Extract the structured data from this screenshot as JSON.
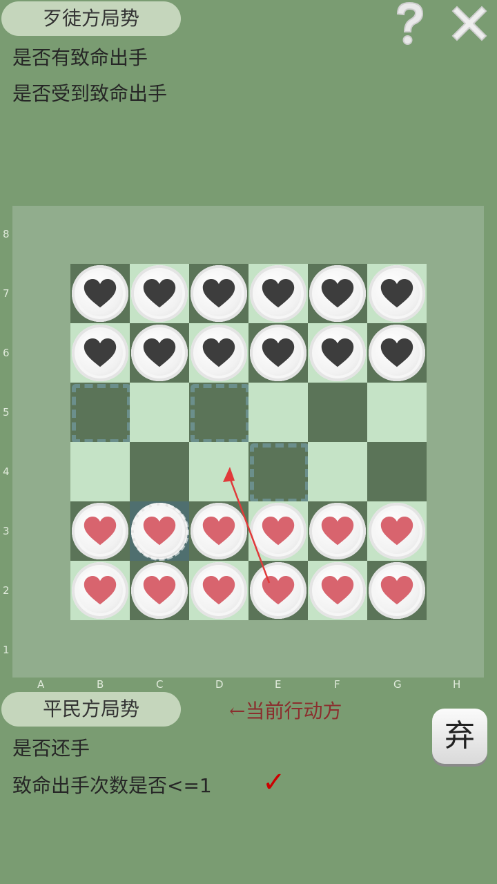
{
  "top_panel": {
    "title": "歹徒方局势",
    "lines": [
      "是否有致命出手",
      "是否受到致命出手"
    ]
  },
  "icons": {
    "help": "question-mark-icon",
    "close": "close-x-icon"
  },
  "board": {
    "rows": [
      "8",
      "7",
      "6",
      "5",
      "4",
      "3",
      "2",
      "1"
    ],
    "cols": [
      "A",
      "B",
      "C",
      "D",
      "E",
      "F",
      "G",
      "H"
    ],
    "colors": {
      "light": "#c5e3c6",
      "dark": "#5b7458",
      "enemy_heart": "#3d3d3d",
      "player_heart": "#d8646e"
    },
    "grid": [
      [
        "dark",
        "light",
        "dark",
        "light",
        "dark",
        "light",
        "dark",
        "light"
      ],
      [
        "light",
        "dark",
        "light",
        "dark",
        "light",
        "dark",
        "light",
        "dark"
      ],
      [
        "dark",
        "light",
        "dark",
        "light",
        "dark",
        "light",
        "dark",
        "light"
      ],
      [
        "light",
        "dark",
        "light",
        "dark",
        "light",
        "dark",
        "light",
        "dark"
      ],
      [
        "dark",
        "light",
        "dark",
        "light",
        "dark",
        "light",
        "dark",
        "light"
      ],
      [
        "light",
        "dark",
        "light",
        "dark",
        "light",
        "dark",
        "light",
        "dark"
      ],
      [
        "dark",
        "light",
        "dark",
        "light",
        "dark",
        "light",
        "dark",
        "light"
      ],
      [
        "light",
        "dark",
        "light",
        "dark",
        "light",
        "dark",
        "light",
        "dark"
      ]
    ],
    "enemy_pieces": [
      "B7",
      "C7",
      "D7",
      "E7",
      "F7",
      "G7",
      "B6",
      "C6",
      "D6",
      "E6",
      "F6",
      "G6"
    ],
    "player_pieces": [
      "B3",
      "C3",
      "D3",
      "E3",
      "F3",
      "G3",
      "B2",
      "C2",
      "D2",
      "E2",
      "F2",
      "G2"
    ],
    "move_targets": [
      "B5",
      "D5",
      "E4"
    ],
    "selected_piece": "C3",
    "arrow": {
      "from": "E2",
      "to": "D4"
    }
  },
  "bottom_panel": {
    "title": "平民方局势",
    "turn_indicator": "←当前行动方",
    "lines": [
      "是否还手",
      "致命出手次数是否<=1"
    ],
    "check": "✓"
  },
  "give_up_button": {
    "label": "弃"
  }
}
